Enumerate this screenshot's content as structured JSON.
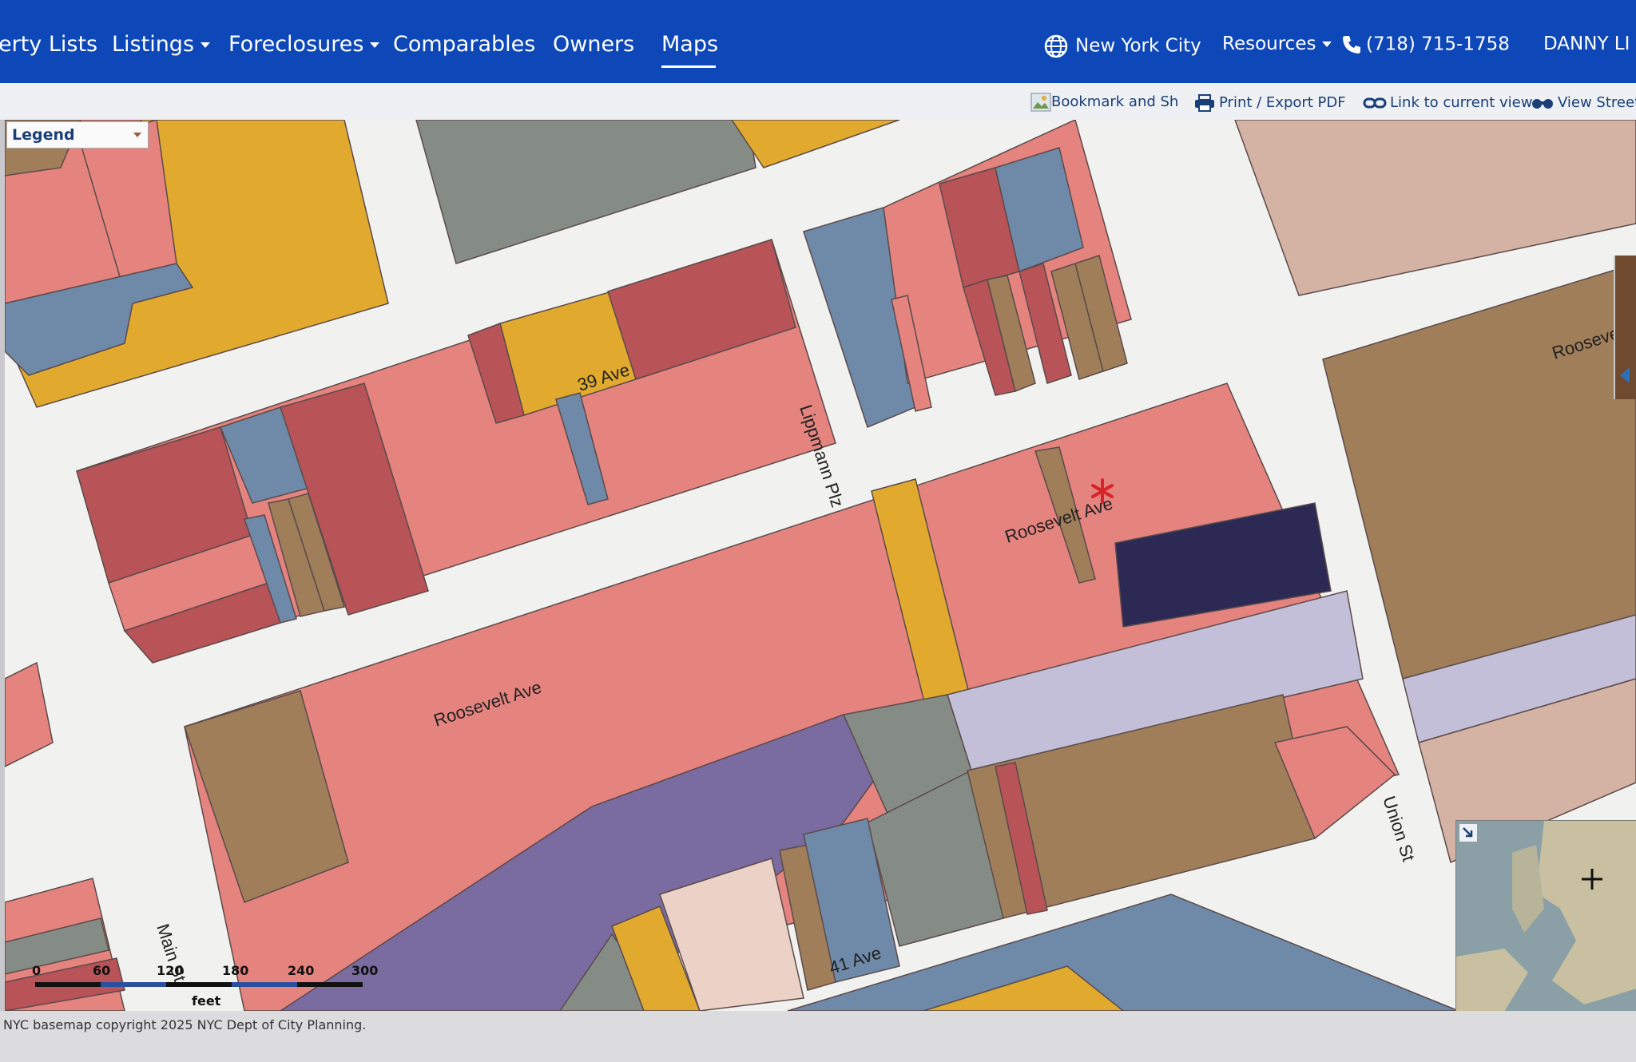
{
  "nav": {
    "lists": "erty Lists",
    "listings": "Listings",
    "foreclosures": "Foreclosures",
    "comparables": "Comparables",
    "owners": "Owners",
    "maps": "Maps",
    "city": "New York City",
    "resources": "Resources",
    "phone": "(718) 715-1758",
    "user": "DANNY LI"
  },
  "toolbar": {
    "bookmark": "Bookmark and Sh",
    "print": "Print / Export PDF",
    "link": "Link to current view",
    "street": "View Street"
  },
  "legend": {
    "label": "Legend"
  },
  "streets": {
    "ave39": "39 Ave",
    "roosevelt_left": "Roosevelt Ave",
    "roosevelt_mid": "Roosevelt Ave",
    "roosevelt_right": "Roosevelt",
    "lippmann": "Lippmann Plz",
    "main": "Main St",
    "union": "Union St",
    "ave41": "41 Ave"
  },
  "scale": {
    "ticks": [
      "0",
      "60",
      "120",
      "180",
      "240",
      "300"
    ],
    "unit": "feet"
  },
  "footer": {
    "copyright": "NYC basemap copyright 2025 NYC Dept of City Planning."
  },
  "colors": {
    "nav": "#0d47b8",
    "commercial": "#e5837f",
    "mixed": "#b85358",
    "industrial": "#6f89a9",
    "residential_1": "#e1aa2f",
    "residential_2": "#a07e5a",
    "public": "#c4bfd8",
    "transport": "#7a6ba0",
    "vacant": "#858c86",
    "marker": "#d6242a"
  },
  "icons": {
    "city": "globe-icon",
    "phone": "phone-icon",
    "print": "printer-icon",
    "link": "chain-link-icon",
    "street": "binoculars-icon",
    "marker": "asterisk-marker-icon"
  }
}
